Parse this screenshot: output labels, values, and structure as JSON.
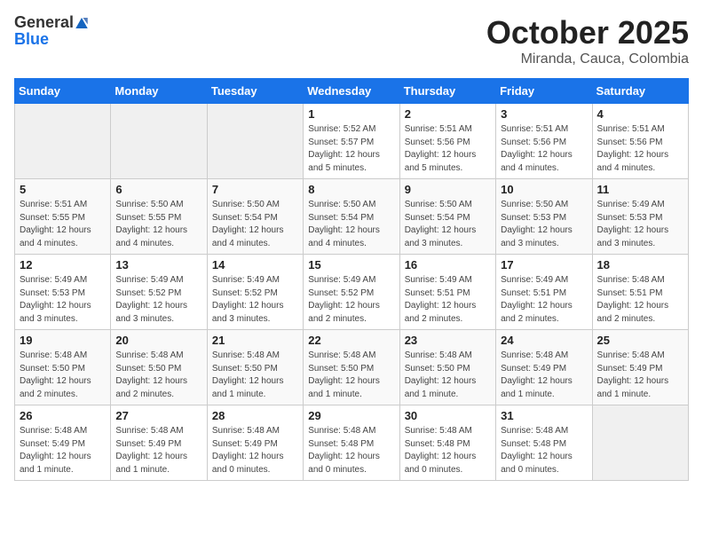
{
  "header": {
    "logo_line1": "General",
    "logo_line2": "Blue",
    "month": "October 2025",
    "location": "Miranda, Cauca, Colombia"
  },
  "weekdays": [
    "Sunday",
    "Monday",
    "Tuesday",
    "Wednesday",
    "Thursday",
    "Friday",
    "Saturday"
  ],
  "weeks": [
    [
      {
        "day": "",
        "sunrise": "",
        "sunset": "",
        "daylight": ""
      },
      {
        "day": "",
        "sunrise": "",
        "sunset": "",
        "daylight": ""
      },
      {
        "day": "",
        "sunrise": "",
        "sunset": "",
        "daylight": ""
      },
      {
        "day": "1",
        "sunrise": "Sunrise: 5:52 AM",
        "sunset": "Sunset: 5:57 PM",
        "daylight": "Daylight: 12 hours and 5 minutes."
      },
      {
        "day": "2",
        "sunrise": "Sunrise: 5:51 AM",
        "sunset": "Sunset: 5:56 PM",
        "daylight": "Daylight: 12 hours and 5 minutes."
      },
      {
        "day": "3",
        "sunrise": "Sunrise: 5:51 AM",
        "sunset": "Sunset: 5:56 PM",
        "daylight": "Daylight: 12 hours and 4 minutes."
      },
      {
        "day": "4",
        "sunrise": "Sunrise: 5:51 AM",
        "sunset": "Sunset: 5:56 PM",
        "daylight": "Daylight: 12 hours and 4 minutes."
      }
    ],
    [
      {
        "day": "5",
        "sunrise": "Sunrise: 5:51 AM",
        "sunset": "Sunset: 5:55 PM",
        "daylight": "Daylight: 12 hours and 4 minutes."
      },
      {
        "day": "6",
        "sunrise": "Sunrise: 5:50 AM",
        "sunset": "Sunset: 5:55 PM",
        "daylight": "Daylight: 12 hours and 4 minutes."
      },
      {
        "day": "7",
        "sunrise": "Sunrise: 5:50 AM",
        "sunset": "Sunset: 5:54 PM",
        "daylight": "Daylight: 12 hours and 4 minutes."
      },
      {
        "day": "8",
        "sunrise": "Sunrise: 5:50 AM",
        "sunset": "Sunset: 5:54 PM",
        "daylight": "Daylight: 12 hours and 4 minutes."
      },
      {
        "day": "9",
        "sunrise": "Sunrise: 5:50 AM",
        "sunset": "Sunset: 5:54 PM",
        "daylight": "Daylight: 12 hours and 3 minutes."
      },
      {
        "day": "10",
        "sunrise": "Sunrise: 5:50 AM",
        "sunset": "Sunset: 5:53 PM",
        "daylight": "Daylight: 12 hours and 3 minutes."
      },
      {
        "day": "11",
        "sunrise": "Sunrise: 5:49 AM",
        "sunset": "Sunset: 5:53 PM",
        "daylight": "Daylight: 12 hours and 3 minutes."
      }
    ],
    [
      {
        "day": "12",
        "sunrise": "Sunrise: 5:49 AM",
        "sunset": "Sunset: 5:53 PM",
        "daylight": "Daylight: 12 hours and 3 minutes."
      },
      {
        "day": "13",
        "sunrise": "Sunrise: 5:49 AM",
        "sunset": "Sunset: 5:52 PM",
        "daylight": "Daylight: 12 hours and 3 minutes."
      },
      {
        "day": "14",
        "sunrise": "Sunrise: 5:49 AM",
        "sunset": "Sunset: 5:52 PM",
        "daylight": "Daylight: 12 hours and 3 minutes."
      },
      {
        "day": "15",
        "sunrise": "Sunrise: 5:49 AM",
        "sunset": "Sunset: 5:52 PM",
        "daylight": "Daylight: 12 hours and 2 minutes."
      },
      {
        "day": "16",
        "sunrise": "Sunrise: 5:49 AM",
        "sunset": "Sunset: 5:51 PM",
        "daylight": "Daylight: 12 hours and 2 minutes."
      },
      {
        "day": "17",
        "sunrise": "Sunrise: 5:49 AM",
        "sunset": "Sunset: 5:51 PM",
        "daylight": "Daylight: 12 hours and 2 minutes."
      },
      {
        "day": "18",
        "sunrise": "Sunrise: 5:48 AM",
        "sunset": "Sunset: 5:51 PM",
        "daylight": "Daylight: 12 hours and 2 minutes."
      }
    ],
    [
      {
        "day": "19",
        "sunrise": "Sunrise: 5:48 AM",
        "sunset": "Sunset: 5:50 PM",
        "daylight": "Daylight: 12 hours and 2 minutes."
      },
      {
        "day": "20",
        "sunrise": "Sunrise: 5:48 AM",
        "sunset": "Sunset: 5:50 PM",
        "daylight": "Daylight: 12 hours and 2 minutes."
      },
      {
        "day": "21",
        "sunrise": "Sunrise: 5:48 AM",
        "sunset": "Sunset: 5:50 PM",
        "daylight": "Daylight: 12 hours and 1 minute."
      },
      {
        "day": "22",
        "sunrise": "Sunrise: 5:48 AM",
        "sunset": "Sunset: 5:50 PM",
        "daylight": "Daylight: 12 hours and 1 minute."
      },
      {
        "day": "23",
        "sunrise": "Sunrise: 5:48 AM",
        "sunset": "Sunset: 5:50 PM",
        "daylight": "Daylight: 12 hours and 1 minute."
      },
      {
        "day": "24",
        "sunrise": "Sunrise: 5:48 AM",
        "sunset": "Sunset: 5:49 PM",
        "daylight": "Daylight: 12 hours and 1 minute."
      },
      {
        "day": "25",
        "sunrise": "Sunrise: 5:48 AM",
        "sunset": "Sunset: 5:49 PM",
        "daylight": "Daylight: 12 hours and 1 minute."
      }
    ],
    [
      {
        "day": "26",
        "sunrise": "Sunrise: 5:48 AM",
        "sunset": "Sunset: 5:49 PM",
        "daylight": "Daylight: 12 hours and 1 minute."
      },
      {
        "day": "27",
        "sunrise": "Sunrise: 5:48 AM",
        "sunset": "Sunset: 5:49 PM",
        "daylight": "Daylight: 12 hours and 1 minute."
      },
      {
        "day": "28",
        "sunrise": "Sunrise: 5:48 AM",
        "sunset": "Sunset: 5:49 PM",
        "daylight": "Daylight: 12 hours and 0 minutes."
      },
      {
        "day": "29",
        "sunrise": "Sunrise: 5:48 AM",
        "sunset": "Sunset: 5:48 PM",
        "daylight": "Daylight: 12 hours and 0 minutes."
      },
      {
        "day": "30",
        "sunrise": "Sunrise: 5:48 AM",
        "sunset": "Sunset: 5:48 PM",
        "daylight": "Daylight: 12 hours and 0 minutes."
      },
      {
        "day": "31",
        "sunrise": "Sunrise: 5:48 AM",
        "sunset": "Sunset: 5:48 PM",
        "daylight": "Daylight: 12 hours and 0 minutes."
      },
      {
        "day": "",
        "sunrise": "",
        "sunset": "",
        "daylight": ""
      }
    ]
  ]
}
